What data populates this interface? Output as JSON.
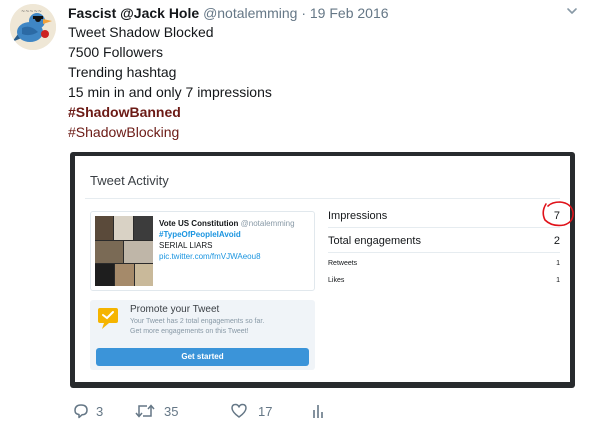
{
  "tweet": {
    "display_name": "Fascist @Jack Hole",
    "handle": "@notalemming",
    "dot": "·",
    "date": "19 Feb 2016",
    "lines": [
      "Tweet Shadow Blocked",
      "7500 Followers",
      "Trending hashtag",
      "15 min in and only 7 impressions"
    ],
    "hashtag_bold": "#ShadowBanned",
    "hashtag": "#ShadowBlocking"
  },
  "activity": {
    "title": "Tweet Activity",
    "preview": {
      "name": "Vote US Constitution",
      "handle": "@notalemming",
      "hashtag": "#TypeOfPeopleIAvoid",
      "text": "SERIAL LIARS",
      "link": "pic.twitter.com/fmVJWAeou8"
    },
    "promo": {
      "title": "Promote your Tweet",
      "sub1": "Your Tweet has 2 total engagements so far.",
      "sub2": "Get more engagements on this Tweet!",
      "button": "Get started"
    },
    "stats": {
      "impressions_label": "Impressions",
      "impressions_value": "7",
      "engagements_label": "Total engagements",
      "engagements_value": "2",
      "retweets_label": "Retweets",
      "retweets_value": "1",
      "likes_label": "Likes",
      "likes_value": "1"
    }
  },
  "actions": {
    "replies": "3",
    "retweets": "35",
    "likes": "17"
  },
  "icons": [
    "bird-avatar-icon",
    "chevron-down-icon",
    "reply-icon",
    "retweet-icon",
    "like-icon",
    "analytics-icon",
    "megaphone-icon"
  ],
  "colors": {
    "hashtag": "#6b1a15",
    "link_blue": "#1b95e0",
    "button_blue": "#3b94d9",
    "annotation_red": "#e0121a",
    "media_frame": "#282b2e"
  }
}
